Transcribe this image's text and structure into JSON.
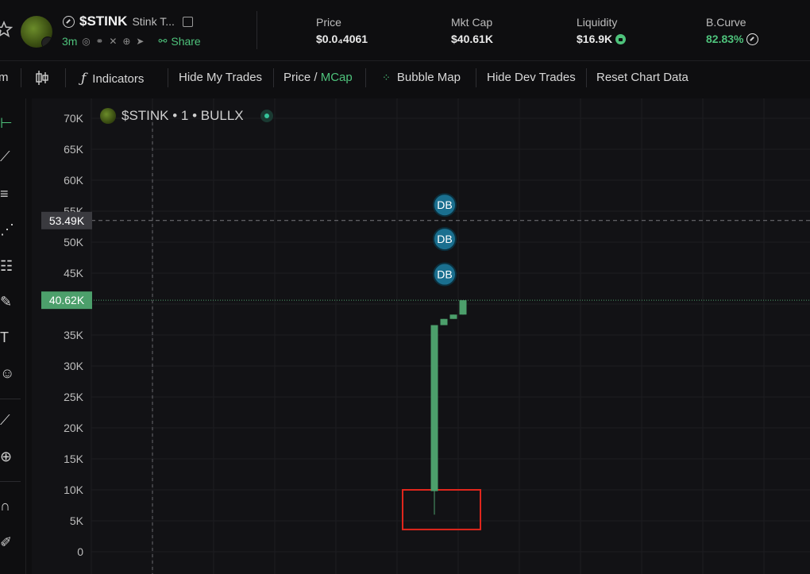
{
  "header": {
    "symbol": "$STINK",
    "name_truncated": "Stink T...",
    "age": "3m",
    "share_label": "Share",
    "stats": [
      {
        "label": "Price",
        "value": "$0.0₄4061"
      },
      {
        "label": "Mkt Cap",
        "value": "$40.61K"
      },
      {
        "label": "Liquidity",
        "value": "$16.9K"
      },
      {
        "label": "B.Curve",
        "value": "82.83%"
      }
    ]
  },
  "toolbar": {
    "partial_label": "m",
    "indicators": "Indicators",
    "hide_my_trades": "Hide My Trades",
    "price": "Price",
    "slash": "/",
    "mcap": "MCap",
    "bubble_map": "Bubble Map",
    "hide_dev_trades": "Hide Dev Trades",
    "reset_chart_data": "Reset Chart Data"
  },
  "left_tools": [
    "crosshair-icon",
    "trend-line-icon",
    "horizontal-lines-icon",
    "pattern-icon",
    "fib-icon",
    "brush-icon",
    "text-icon",
    "emoji-icon",
    "ruler-icon",
    "zoom-icon",
    "magnet-icon",
    "lock-draw-icon"
  ],
  "chart": {
    "legend": "$STINK • 1 • BULLX",
    "crosshair_label": "53.49K",
    "current_label": "40.62K",
    "colors": {
      "up": "#4c9f6b",
      "accent_green": "#4ec27b",
      "marker": "#1a6f8f",
      "highlight": "#e0261c"
    }
  },
  "chart_data": {
    "type": "candlestick",
    "ylabel": "",
    "y_ticks": [
      "70K",
      "65K",
      "60K",
      "55K",
      "50K",
      "45K",
      "40K",
      "35K",
      "30K",
      "25K",
      "20K",
      "15K",
      "10K",
      "5K",
      "0"
    ],
    "ylim": [
      0,
      70000
    ],
    "crosshair_value": 53490,
    "current_value": 40620,
    "candles": [
      {
        "open": 9800,
        "high": 36600,
        "low": 6000,
        "close": 36600
      },
      {
        "open": 36600,
        "high": 37600,
        "low": 36600,
        "close": 37600
      },
      {
        "open": 37600,
        "high": 38300,
        "low": 37600,
        "close": 38300
      },
      {
        "open": 38300,
        "high": 40620,
        "low": 38300,
        "close": 40620
      }
    ],
    "markers": [
      {
        "label": "DB",
        "value": 56000
      },
      {
        "label": "DB",
        "value": 50500
      },
      {
        "label": "DB",
        "value": 44800
      }
    ]
  }
}
